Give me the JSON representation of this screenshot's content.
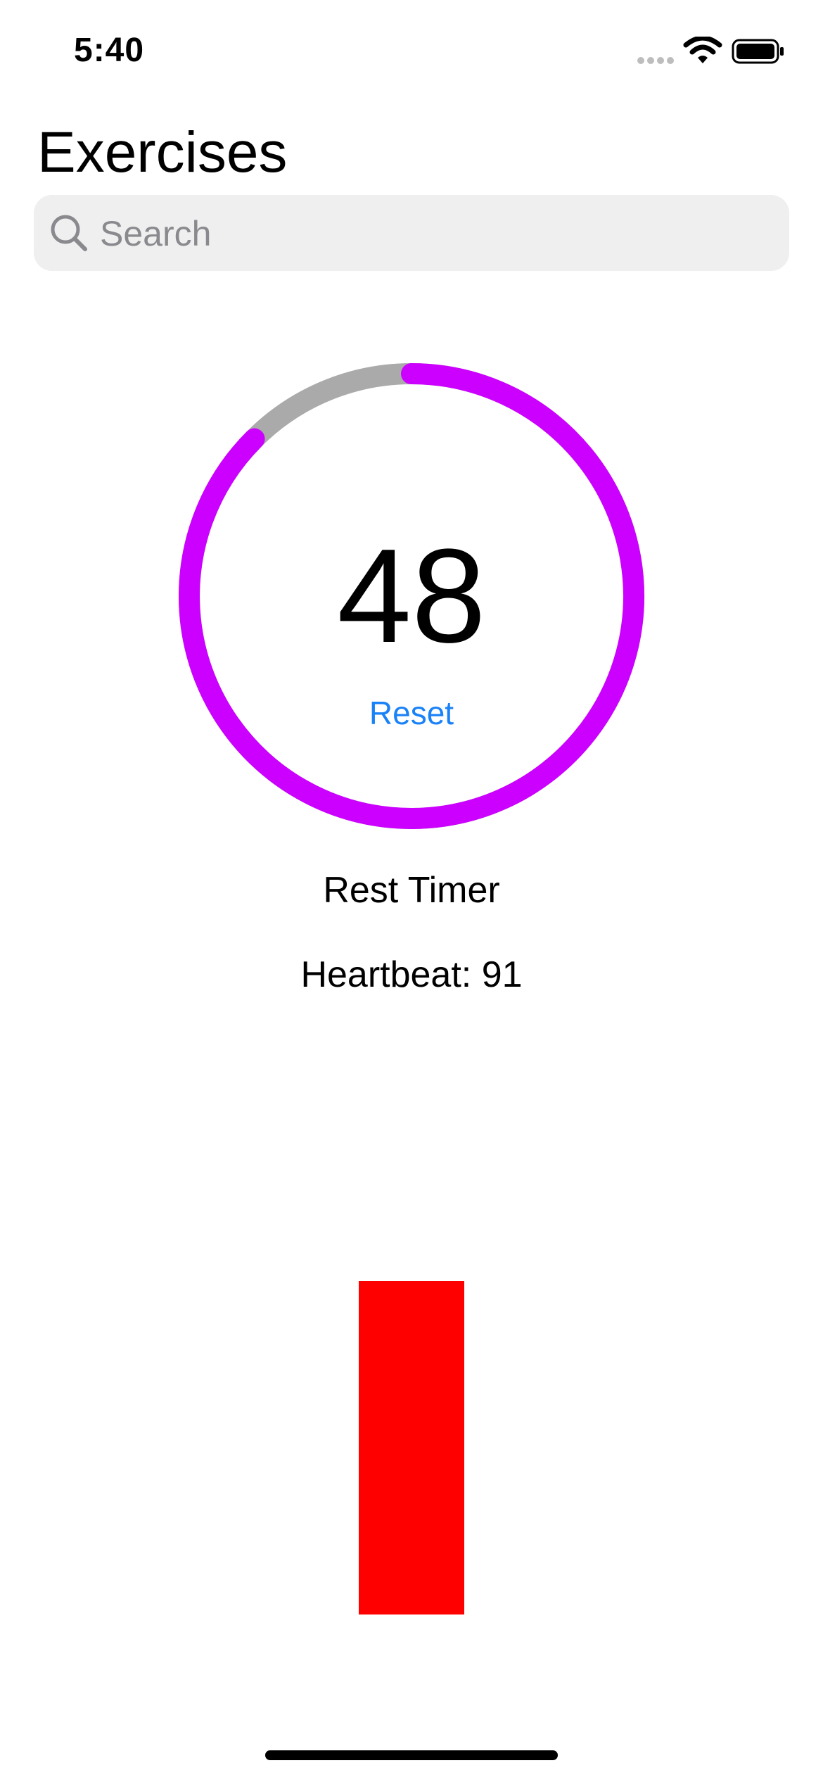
{
  "status_bar": {
    "time": "5:40",
    "icons": [
      "cellular-signal-icon",
      "wifi-icon",
      "battery-icon"
    ]
  },
  "header": {
    "title": "Exercises"
  },
  "search": {
    "icon": "search-icon",
    "placeholder": "Search",
    "value": ""
  },
  "timer": {
    "value": "48",
    "progress_fraction": 0.875,
    "reset_label": "Reset",
    "label": "Rest Timer",
    "colors": {
      "progress": "#cc00ff",
      "track": "#aaaaaa"
    }
  },
  "heartbeat": {
    "label": "Heartbeat:",
    "value": "91",
    "bar_color": "#ff0000"
  }
}
